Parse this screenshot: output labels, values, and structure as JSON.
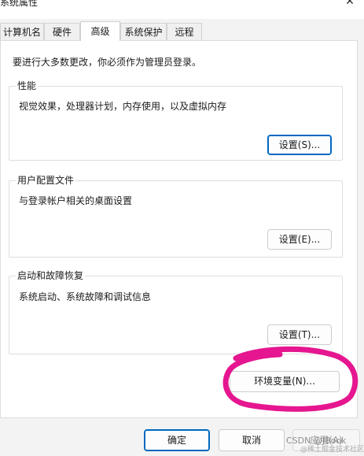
{
  "window": {
    "title": "系统属性",
    "close_glyph": "✕"
  },
  "tabs": [
    {
      "label": "计算机名",
      "active": false
    },
    {
      "label": "硬件",
      "active": false
    },
    {
      "label": "高级",
      "active": true
    },
    {
      "label": "系统保护",
      "active": false
    },
    {
      "label": "远程",
      "active": false
    }
  ],
  "advanced": {
    "admin_note": "要进行大多数更改，你必须作为管理员登录。",
    "performance": {
      "title": "性能",
      "description": "视觉效果，处理器计划，内存使用，以及虚拟内存",
      "button": "设置(S)..."
    },
    "user_profiles": {
      "title": "用户配置文件",
      "description": "与登录帐户相关的桌面设置",
      "button": "设置(E)..."
    },
    "startup_recovery": {
      "title": "启动和故障恢复",
      "description": "系统启动、系统故障和调试信息",
      "button": "设置(T)..."
    },
    "env_button": "环境变量(N)..."
  },
  "footer": {
    "ok": "确定",
    "cancel": "取消",
    "apply": "应用(A)"
  },
  "watermark": {
    "line1": "CSDN @JBook",
    "line2": "@稀土掘金技术社区"
  },
  "colors": {
    "annotation": "#e5168f",
    "accent": "#0067c0"
  },
  "icons": {
    "close": "close-icon"
  }
}
